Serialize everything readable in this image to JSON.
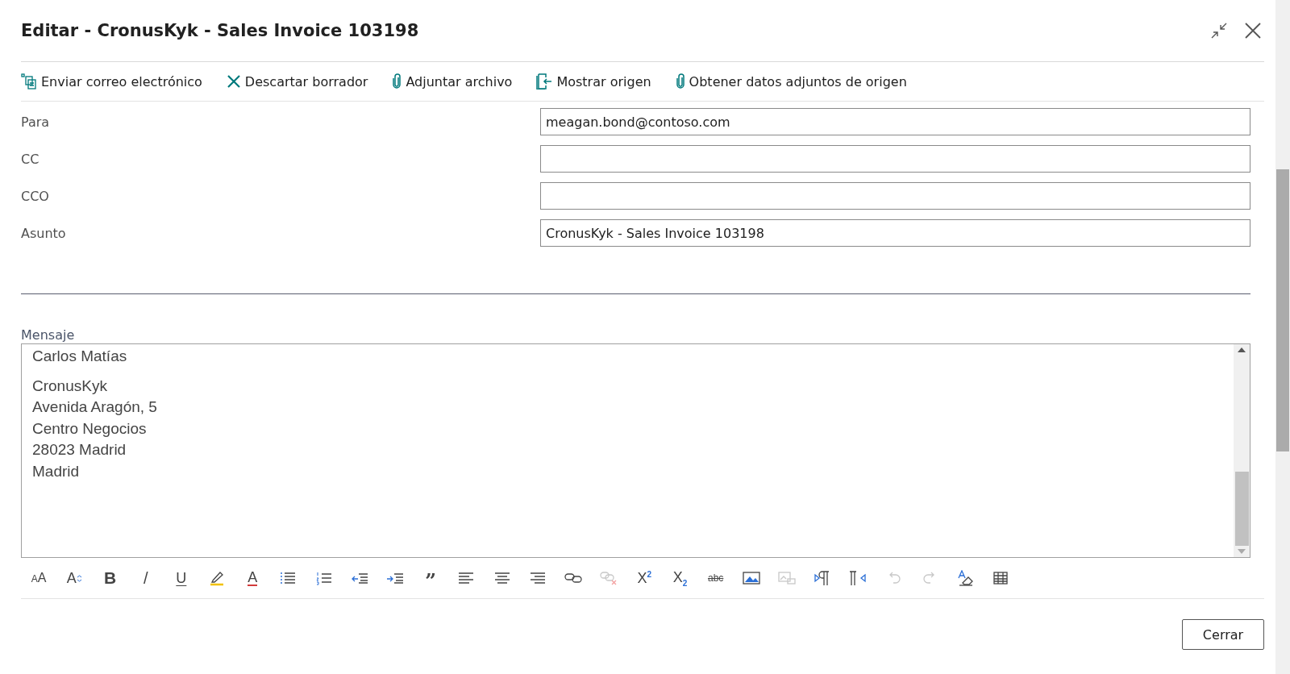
{
  "dialog": {
    "title": "Editar - CronusKyk - Sales Invoice 103198"
  },
  "actions": [
    {
      "kind": "email",
      "label": "Enviar correo electrónico"
    },
    {
      "kind": "discard",
      "label": "Descartar borrador"
    },
    {
      "kind": "attach",
      "label": "Adjuntar archivo"
    },
    {
      "kind": "source",
      "label": "Mostrar origen"
    },
    {
      "kind": "attach",
      "label": "Obtener datos adjuntos de origen"
    }
  ],
  "fields": [
    {
      "label": "Para",
      "value": "meagan.bond@contoso.com"
    },
    {
      "label": "CC"
    },
    {
      "label": "CCO"
    },
    {
      "label": "Asunto",
      "value": "CronusKyk - Sales Invoice 103198"
    }
  ],
  "message": {
    "label": "Mensaje",
    "paragraphs": [
      [
        "Carlos Matías"
      ],
      [
        "CronusKyk",
        "Avenida Aragón, 5",
        "Centro Negocios",
        "28023 Madrid",
        "Madrid"
      ]
    ]
  },
  "editor_tools": [
    {
      "kind": "font-size",
      "text": "AA",
      "disabled": false
    },
    {
      "kind": "grow-font",
      "text": "A",
      "disabled": false
    },
    {
      "kind": "bold",
      "text": "B",
      "disabled": false
    },
    {
      "kind": "italic",
      "text": "/",
      "disabled": false
    },
    {
      "kind": "underline",
      "text": "U",
      "disabled": false
    },
    {
      "kind": "highlight",
      "disabled": false
    },
    {
      "kind": "font-color",
      "text": "A",
      "disabled": false
    },
    {
      "kind": "bullets",
      "disabled": false
    },
    {
      "kind": "numbering",
      "disabled": false
    },
    {
      "kind": "outdent",
      "disabled": false
    },
    {
      "kind": "indent",
      "disabled": false
    },
    {
      "kind": "quote",
      "text": "”",
      "disabled": false
    },
    {
      "kind": "align-left",
      "disabled": false
    },
    {
      "kind": "align-center",
      "disabled": false
    },
    {
      "kind": "align-right",
      "disabled": false
    },
    {
      "kind": "link",
      "disabled": false
    },
    {
      "kind": "unlink",
      "disabled": true
    },
    {
      "kind": "superscript",
      "text": "X$^{2}$",
      "disabled": false
    },
    {
      "kind": "subscript",
      "text": "X$_{2}$",
      "disabled": false
    },
    {
      "kind": "strikethrough",
      "text": "abc",
      "disabled": false
    },
    {
      "kind": "image",
      "disabled": false
    },
    {
      "kind": "image-edit",
      "disabled": true
    },
    {
      "kind": "ltr",
      "disabled": false
    },
    {
      "kind": "rtl",
      "disabled": false
    },
    {
      "kind": "undo",
      "disabled": true
    },
    {
      "kind": "redo",
      "disabled": true
    },
    {
      "kind": "clear-format",
      "disabled": false
    },
    {
      "kind": "table",
      "disabled": false
    }
  ],
  "footer": {
    "close_button": "Cerrar"
  }
}
